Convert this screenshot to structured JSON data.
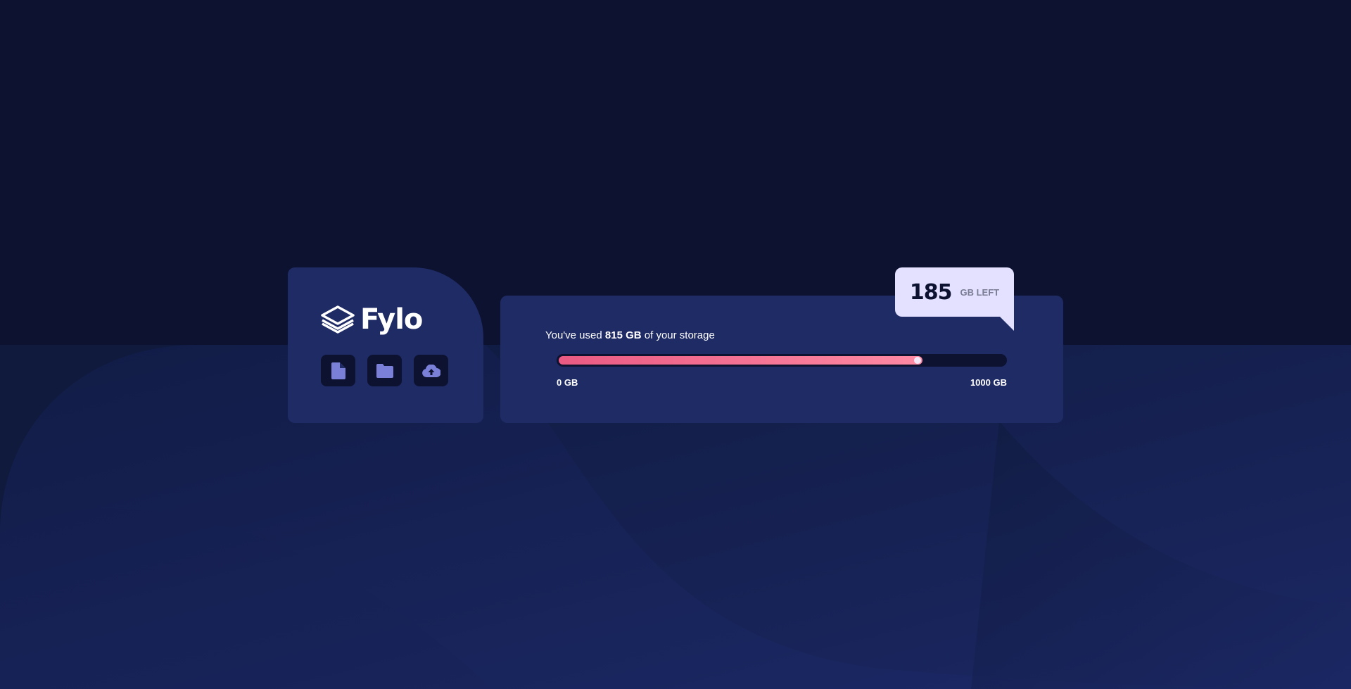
{
  "brand": {
    "name": "Fylo",
    "logo_icon": "layers-icon"
  },
  "actions": [
    {
      "icon": "document-icon",
      "label": "Document"
    },
    {
      "icon": "folder-icon",
      "label": "Folder"
    },
    {
      "icon": "upload-icon",
      "label": "Upload"
    }
  ],
  "storage": {
    "used_prefix": "You've used ",
    "used_amount": "815 GB",
    "used_suffix": " of your storage",
    "used_fraction": 0.815,
    "min_label": "0 GB",
    "max_label": "1000 GB"
  },
  "remaining": {
    "number": "185",
    "unit": "GB LEFT"
  },
  "colors": {
    "background": "#0c1230",
    "card": "#1f2b65",
    "accent_start": "#ea5a83",
    "accent_end": "#fe8aa4",
    "bubble": "#e3e1ff",
    "icon": "#7a80d8"
  }
}
